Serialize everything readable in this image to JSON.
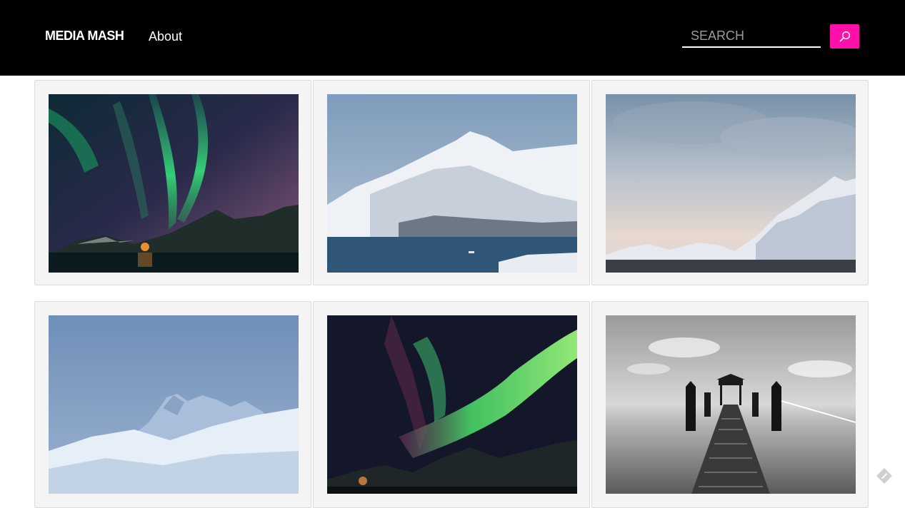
{
  "nav": {
    "brand": "MEDIA MASH",
    "about": "About"
  },
  "search": {
    "placeholder": "SEARCH",
    "button_icon": "search-icon",
    "button_color": "#ff10a8"
  },
  "gallery": {
    "photos": [
      {
        "subject": "aurora-over-fjord-icon"
      },
      {
        "subject": "snowy-mountain-over-water-icon"
      },
      {
        "subject": "cloudy-sky-snowy-peak-icon"
      },
      {
        "subject": "snow-mountain-blue-sky-icon"
      },
      {
        "subject": "aurora-over-mountains-icon"
      },
      {
        "subject": "black-white-pier-icon"
      }
    ]
  }
}
